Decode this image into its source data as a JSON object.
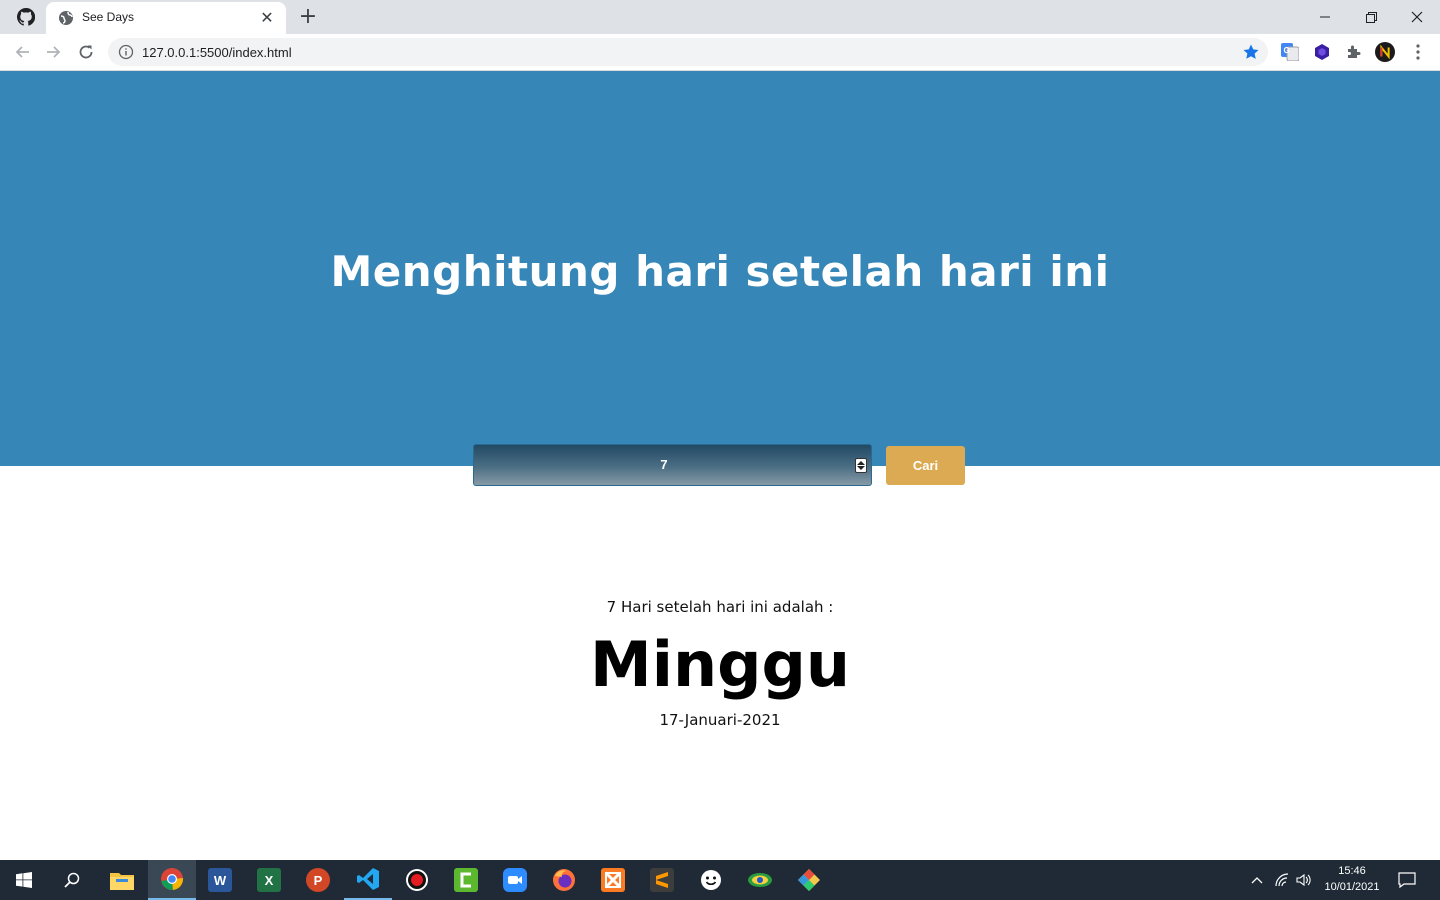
{
  "browser": {
    "tab_title": "See Days",
    "url": "127.0.0.1:5500/index.html",
    "bookmark_color": "#1a73e8"
  },
  "page": {
    "hero_color": "#3687b7",
    "title": "Menghitung hari setelah hari ini",
    "input_value": "7",
    "search_button": "Cari",
    "button_color": "#dcaa52",
    "result_label": "7 Hari setelah hari ini adalah :",
    "result_day": "Minggu",
    "result_date": "17-Januari-2021"
  },
  "taskbar": {
    "apps": [
      "start-icon",
      "search-icon",
      "file-explorer-icon",
      "chrome-icon",
      "word-icon",
      "excel-icon",
      "powerpoint-icon",
      "vscode-icon",
      "recorder-icon",
      "camtasia-icon",
      "zoom-icon",
      "firefox-icon",
      "xampp-icon",
      "sublime-icon",
      "emoji-app-icon",
      "app-icon",
      "git-icon"
    ],
    "time": "15:46",
    "date": "10/01/2021"
  }
}
